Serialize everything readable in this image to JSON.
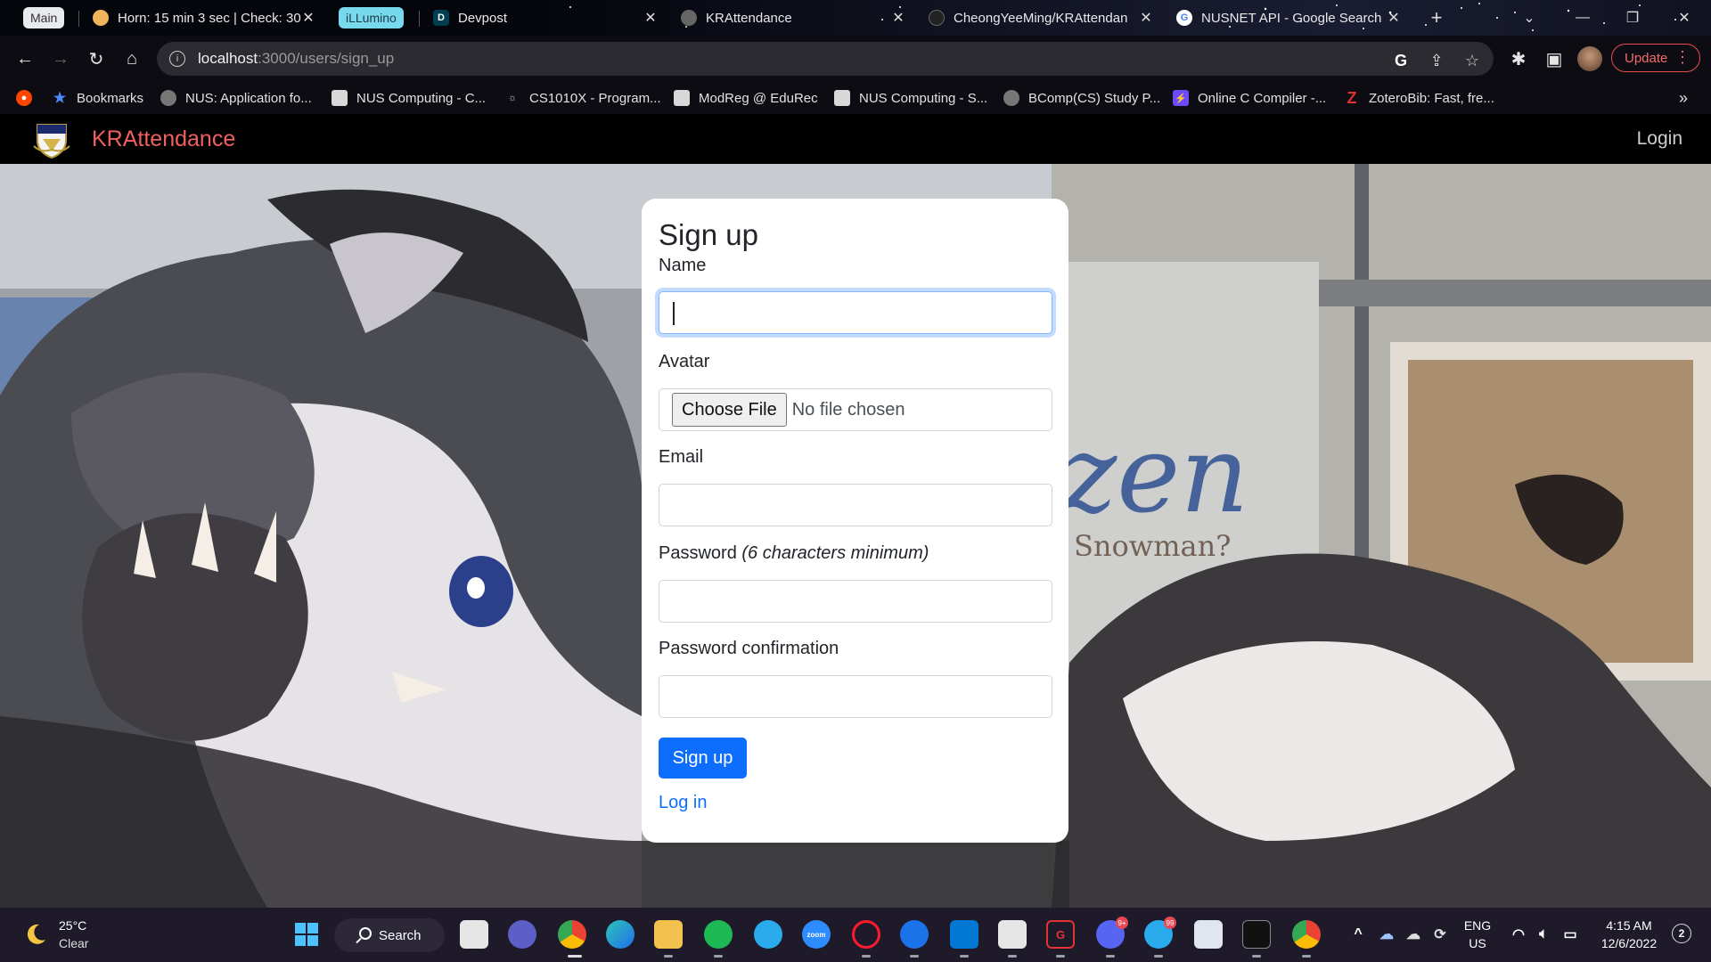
{
  "browser": {
    "tabs": [
      {
        "label": "Main",
        "kind": "group"
      },
      {
        "label": "Horn: 15 min 3 sec | Check: 30",
        "kind": "tab"
      },
      {
        "label": "iLLumino",
        "kind": "group"
      },
      {
        "label": "Devpost",
        "kind": "tab"
      },
      {
        "label": "KRAttendance",
        "kind": "tab"
      },
      {
        "label": "CheongYeeMing/KRAttendan",
        "kind": "tab"
      },
      {
        "label": "NUSNET API - Google Search",
        "kind": "tab"
      }
    ],
    "new_tab_symbol": "+",
    "url_host": "localhost",
    "url_path": ":3000/users/sign_up",
    "update_label": "Update",
    "bookmarks": [
      {
        "label": "Bookmarks"
      },
      {
        "label": "NUS: Application fo..."
      },
      {
        "label": "NUS Computing - C..."
      },
      {
        "label": "CS1010X - Program..."
      },
      {
        "label": "ModReg @ EduRec"
      },
      {
        "label": "NUS Computing - S..."
      },
      {
        "label": "BComp(CS) Study P..."
      },
      {
        "label": "Online C Compiler -..."
      },
      {
        "label": "ZoteroBib: Fast, fre..."
      }
    ],
    "bookmarks_overflow": "»"
  },
  "app": {
    "brand": "KRAttendance",
    "nav_login": "Login"
  },
  "form": {
    "title": "Sign up",
    "name_label": "Name",
    "avatar_label": "Avatar",
    "file_button": "Choose File",
    "file_status": "No file chosen",
    "email_label": "Email",
    "password_label": "Password",
    "password_hint": "(6 characters minimum)",
    "password_confirmation_label": "Password confirmation",
    "submit_label": "Sign up",
    "login_link": "Log in"
  },
  "taskbar": {
    "temperature": "25°C",
    "condition": "Clear",
    "search_label": "Search",
    "language_top": "ENG",
    "language_bottom": "US",
    "time": "4:15 AM",
    "date": "12/6/2022",
    "notification_count": "2",
    "discord_badge": "9+",
    "telegram_badge": "99"
  },
  "colors": {
    "brand": "#f16060",
    "primary": "#0d6efd",
    "update_border": "#e84b4b"
  }
}
